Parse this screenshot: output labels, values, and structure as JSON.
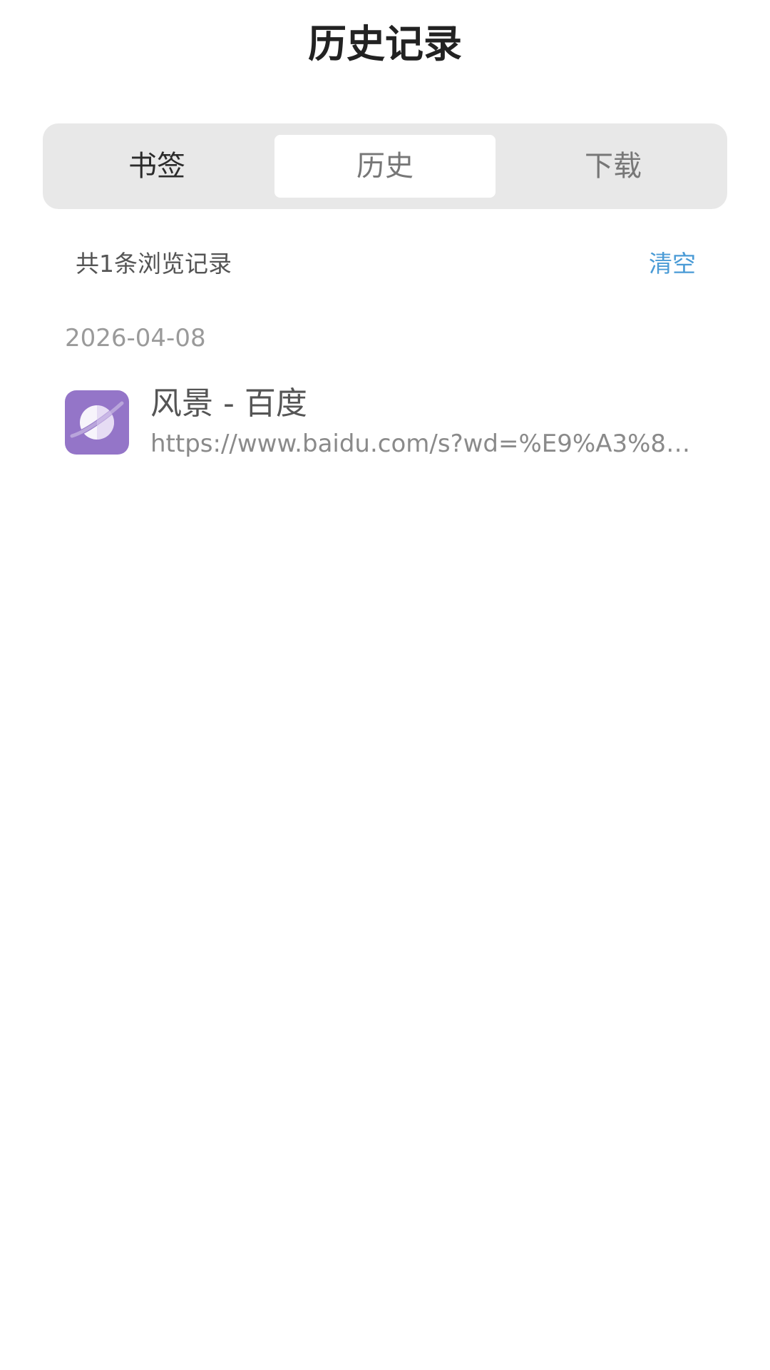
{
  "header": {
    "title": "历史记录"
  },
  "tabs": [
    {
      "label": "书签",
      "active": false
    },
    {
      "label": "历史",
      "active": true
    },
    {
      "label": "下载",
      "active": false
    }
  ],
  "summary": {
    "count_text": "共1条浏览记录",
    "clear_label": "清空"
  },
  "history": {
    "groups": [
      {
        "date": "2026-04-08",
        "items": [
          {
            "title": "风景 - 百度",
            "url": "https://www.baidu.com/s?wd=%E9%A3%8E%...",
            "icon": "planet-browser-icon"
          }
        ]
      }
    ]
  },
  "colors": {
    "accent": "#4a9bd6",
    "icon_bg": "#9475c8",
    "segment_bg": "#e8e8e8"
  }
}
